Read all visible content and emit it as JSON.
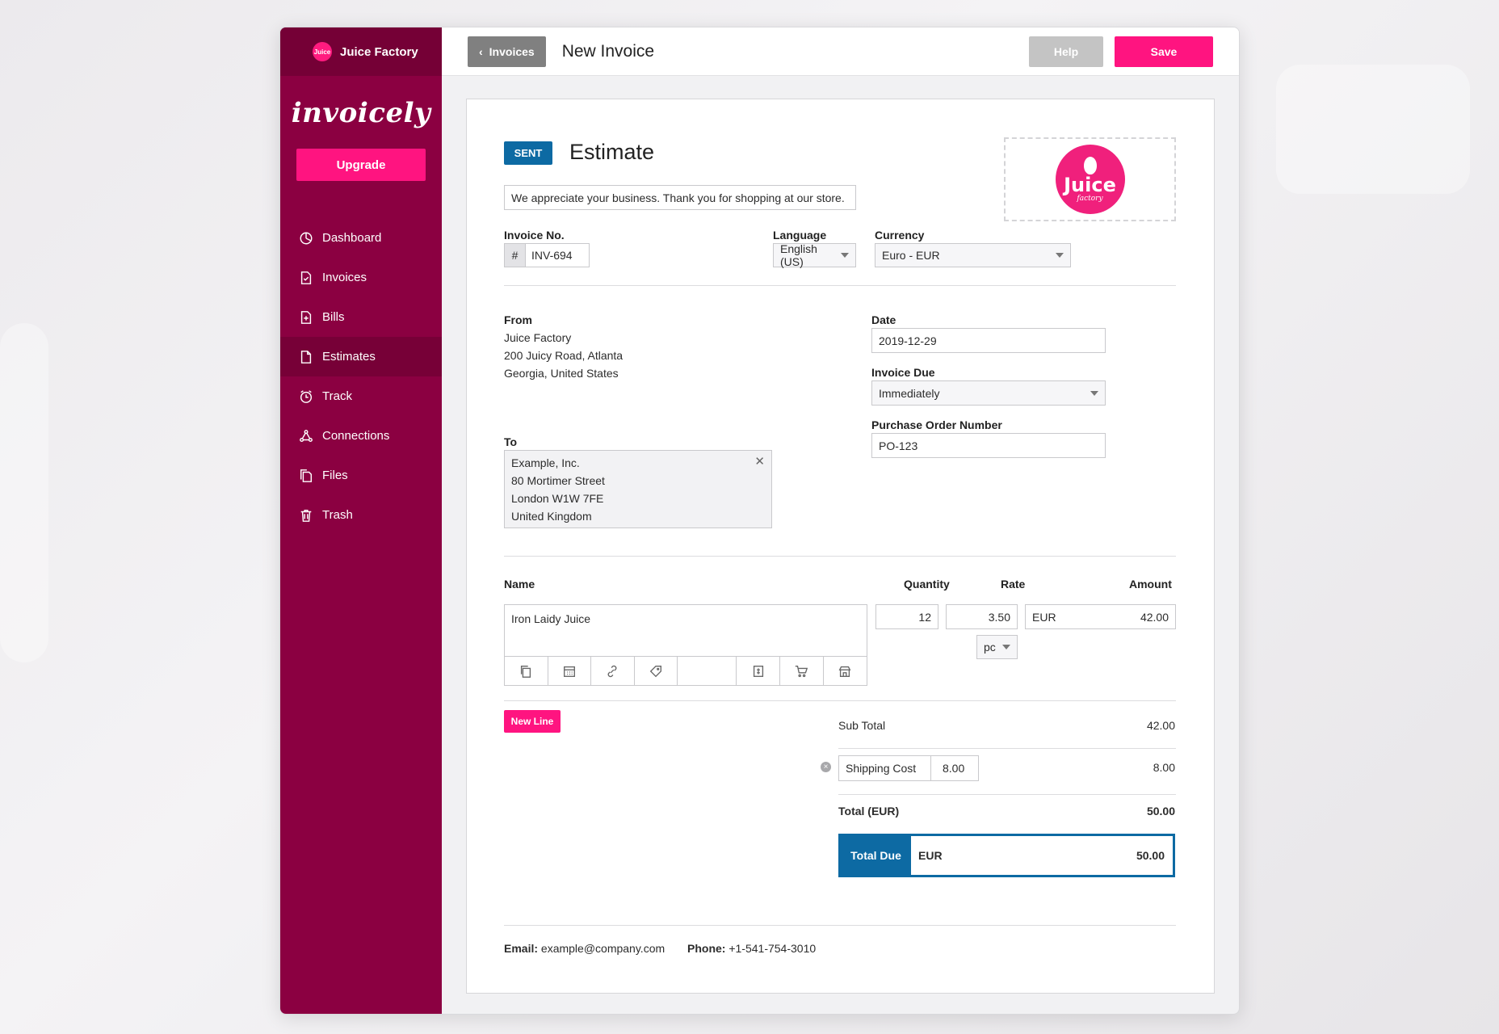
{
  "sidebar": {
    "company_name": "Juice Factory",
    "company_logo_text": "Juice",
    "brand": "invoicely",
    "upgrade_label": "Upgrade",
    "items": [
      {
        "label": "Dashboard",
        "icon": "dashboard-icon"
      },
      {
        "label": "Invoices",
        "icon": "invoices-icon"
      },
      {
        "label": "Bills",
        "icon": "bills-icon"
      },
      {
        "label": "Estimates",
        "icon": "estimates-icon",
        "active": true
      },
      {
        "label": "Track",
        "icon": "clock-icon"
      },
      {
        "label": "Connections",
        "icon": "connections-icon"
      },
      {
        "label": "Files",
        "icon": "files-icon"
      },
      {
        "label": "Trash",
        "icon": "trash-icon"
      }
    ]
  },
  "topbar": {
    "back_label": "Invoices",
    "title": "New Invoice",
    "help_label": "Help",
    "save_label": "Save"
  },
  "document": {
    "status": "SENT",
    "title": "Estimate",
    "logo_word": "Juice",
    "logo_sub": "factory",
    "message": "We appreciate your business. Thank you for shopping at our store.",
    "invoice_no_label": "Invoice No.",
    "invoice_no_prefix": "#",
    "invoice_no": "INV-694",
    "language_label": "Language",
    "language": "English (US)",
    "currency_label": "Currency",
    "currency": "Euro - EUR",
    "from_label": "From",
    "from_lines": [
      "Juice Factory",
      "200 Juicy Road, Atlanta",
      "Georgia, United States"
    ],
    "to_label": "To",
    "to_lines": [
      "Example, Inc.",
      "80 Mortimer Street",
      "London W1W 7FE",
      "United Kingdom"
    ],
    "date_label": "Date",
    "date": "2019-12-29",
    "due_label": "Invoice Due",
    "due": "Immediately",
    "po_label": "Purchase Order Number",
    "po": "PO-123"
  },
  "items": {
    "headers": {
      "name": "Name",
      "quantity": "Quantity",
      "rate": "Rate",
      "amount": "Amount"
    },
    "row": {
      "name": "Iron Laidy Juice",
      "quantity": "12",
      "rate": "3.50",
      "unit": "pc",
      "currency": "EUR",
      "amount": "42.00"
    },
    "new_line_label": "New Line"
  },
  "totals": {
    "subtotal_label": "Sub Total",
    "subtotal": "42.00",
    "shipping_label": "Shipping Cost",
    "shipping_input": "8.00",
    "shipping": "8.00",
    "total_label": "Total (EUR)",
    "total": "50.00",
    "total_due_label": "Total Due",
    "total_due_currency": "EUR",
    "total_due": "50.00"
  },
  "footer": {
    "email_label": "Email:",
    "email": "example@company.com",
    "phone_label": "Phone:",
    "phone": "+1-541-754-3010"
  },
  "colors": {
    "sidebar": "#8b0041",
    "accent": "#ff1480",
    "status": "#0d6aa3"
  }
}
